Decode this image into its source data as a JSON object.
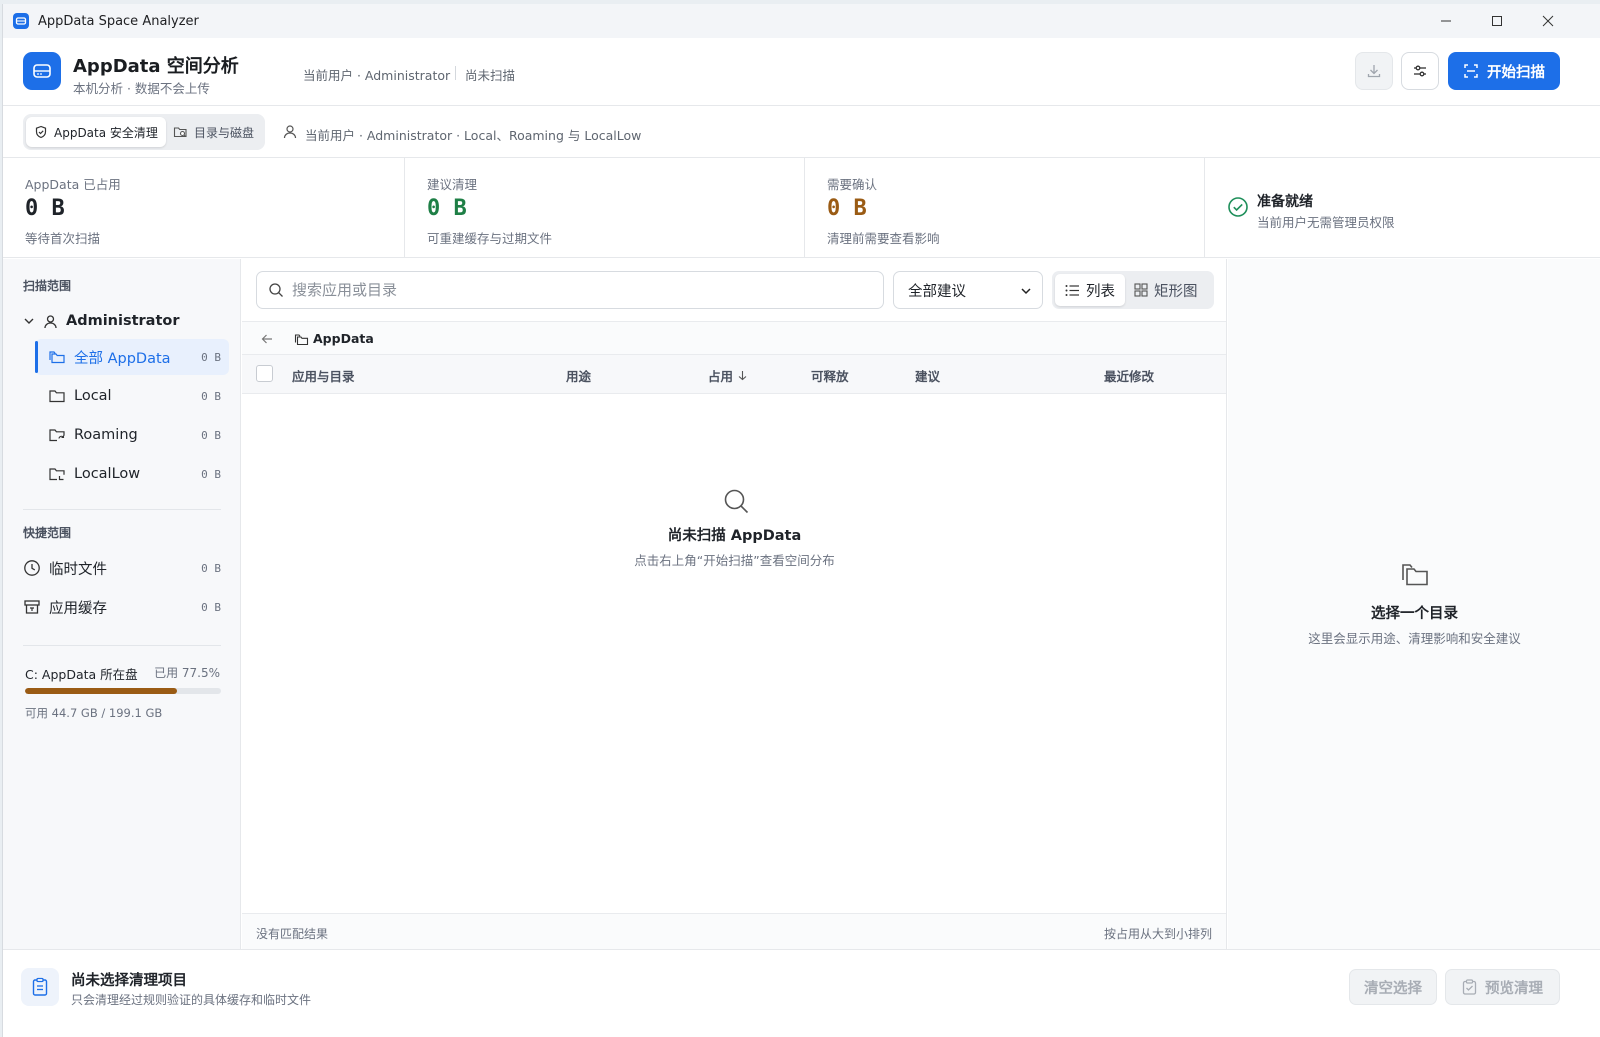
{
  "window": {
    "title": "AppData Space Analyzer"
  },
  "header": {
    "title": "AppData 空间分析",
    "subtitle": "本机分析 · 数据不会上传",
    "user": "当前用户 · Administrator",
    "status": "尚未扫描",
    "scan_label": "开始扫描"
  },
  "modes": {
    "items": [
      {
        "label": "AppData 安全清理",
        "active": true
      },
      {
        "label": "目录与磁盘",
        "active": false
      }
    ],
    "scope": "当前用户 · Administrator · Local、Roaming 与 LocalLow"
  },
  "stats": [
    {
      "label": "AppData 已占用",
      "value": "0 B",
      "note": "等待首次扫描",
      "color": "#1f2329"
    },
    {
      "label": "建议清理",
      "value": "0 B",
      "note": "可重建缓存与过期文件",
      "color": "#1e7f46"
    },
    {
      "label": "需要确认",
      "value": "0 B",
      "note": "清理前需要查看影响",
      "color": "#9a5b14"
    }
  ],
  "ready": {
    "title": "准备就绪",
    "subtitle": "当前用户无需管理员权限"
  },
  "sidebar": {
    "scope_title": "扫描范围",
    "root": "Administrator",
    "items": [
      {
        "label": "全部 AppData",
        "size": "0 B",
        "icon": "folders-icon",
        "active": true
      },
      {
        "label": "Local",
        "size": "0 B",
        "icon": "folder-icon",
        "active": false
      },
      {
        "label": "Roaming",
        "size": "0 B",
        "icon": "folder-sync-icon",
        "active": false
      },
      {
        "label": "LocalLow",
        "size": "0 B",
        "icon": "folder-low-icon",
        "active": false
      }
    ],
    "quick_title": "快捷范围",
    "quick": [
      {
        "label": "临时文件",
        "size": "0 B",
        "icon": "clock-icon"
      },
      {
        "label": "应用缓存",
        "size": "0 B",
        "icon": "archive-icon"
      }
    ],
    "disk": {
      "name": "C: AppData 所在盘",
      "used_label": "已用 77.5%",
      "used_pct": 77.5,
      "free": "可用 44.7 GB / 199.1 GB"
    }
  },
  "main": {
    "search_placeholder": "搜索应用或目录",
    "filter": "全部建议",
    "views": [
      {
        "label": "列表",
        "active": true
      },
      {
        "label": "矩形图",
        "active": false
      }
    ],
    "path": "AppData",
    "columns": [
      "应用与目录",
      "用途",
      "占用",
      "可释放",
      "建议",
      "最近修改"
    ],
    "empty_title": "尚未扫描 AppData",
    "empty_sub": "点击右上角“开始扫描”查看空间分布",
    "footer_left": "没有匹配结果",
    "footer_right": "按占用从大到小排列"
  },
  "detail": {
    "title": "选择一个目录",
    "subtitle": "这里会显示用途、清理影响和安全建议"
  },
  "bottom": {
    "title": "尚未选择清理项目",
    "subtitle": "只会清理经过规则验证的具体缓存和临时文件",
    "clear_label": "清空选择",
    "preview_label": "预览清理"
  }
}
